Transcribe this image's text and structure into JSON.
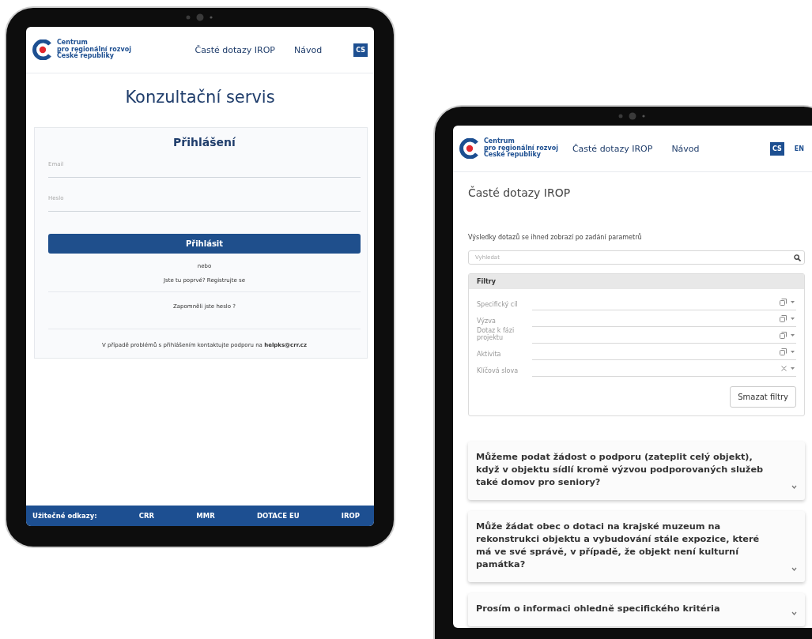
{
  "left_tablet": {
    "header": {
      "logo_text": [
        "Centrum",
        "pro regionální rozvoj",
        "České republiky"
      ],
      "nav": [
        "Časté dotazy IROP",
        "Návod"
      ],
      "languages": [
        {
          "label": "CS",
          "selected": true
        }
      ]
    },
    "page_title": "Konzultační servis",
    "login": {
      "title": "Přihlášení",
      "fields": [
        {
          "placeholder": "Email"
        },
        {
          "placeholder": "Heslo"
        }
      ],
      "submit": "Přihlásit",
      "separator": "nebo",
      "register_prompt": "Jste tu poprvé?",
      "register_link": "Registrujte se",
      "forgot": "Zapomněli jste heslo ?",
      "support_text": "V případě problémů s přihlášením kontaktujte podporu na",
      "support_link": "helpks@crr.cz"
    },
    "footer": {
      "label": "Užitečné odkazy:",
      "links": [
        "CRR",
        "MMR",
        "DOTACE EU",
        "IROP"
      ]
    }
  },
  "right_tablet": {
    "header": {
      "logo_text": [
        "Centrum",
        "pro regionální rozvoj",
        "České republiky"
      ],
      "nav": [
        "Časté dotazy IROP",
        "Návod"
      ],
      "languages": [
        {
          "label": "CS",
          "selected": true
        },
        {
          "label": "EN",
          "selected": false
        }
      ]
    },
    "page_title": "Časté dotazy IROP",
    "intro": "Výsledky dotazů se ihned zobrazí po zadání parametrů",
    "search": {
      "placeholder": "Vyhledat"
    },
    "filters": {
      "title": "Filtry",
      "items": [
        {
          "label": "Specifický cíl",
          "kind": "select"
        },
        {
          "label": "Výzva",
          "kind": "select"
        },
        {
          "label": "Dotaz k fázi projektu",
          "kind": "select"
        },
        {
          "label": "Aktivita",
          "kind": "select"
        },
        {
          "label": "Klíčová slova",
          "kind": "tags"
        }
      ],
      "clear_button": "Smazat filtry"
    },
    "faqs": [
      {
        "question": "Můžeme podat žádost o podporu (zateplit celý objekt), když v objektu sídlí kromě výzvou podporovaných služeb také domov pro seniory?",
        "expanded": false
      },
      {
        "question": "Může žádat obec o dotaci na krajské muzeum na rekonstrukci objektu a vybudování stále expozice, které má ve své správě, v případě, že objekt není kulturní památka?",
        "expanded": false
      },
      {
        "question": "Prosím o informaci ohledně specifického kritéria",
        "expanded": false
      }
    ]
  }
}
